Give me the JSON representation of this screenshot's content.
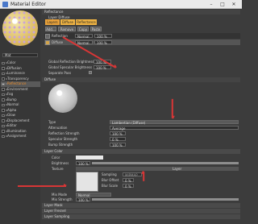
{
  "window": {
    "title": "Material Editor"
  },
  "material_name": "Mat",
  "channels": [
    {
      "label": "Color",
      "on": false
    },
    {
      "label": "Diffusion",
      "on": false
    },
    {
      "label": "Luminance",
      "on": false
    },
    {
      "label": "Transparency",
      "on": false
    },
    {
      "label": "Reflectance",
      "on": true,
      "selected": true
    },
    {
      "label": "Environment",
      "on": false
    },
    {
      "label": "Fog",
      "on": false
    },
    {
      "label": "Bump",
      "on": false
    },
    {
      "label": "Normal",
      "on": false
    },
    {
      "label": "Alpha",
      "on": false
    },
    {
      "label": "Glow",
      "on": false
    },
    {
      "label": "Displacement",
      "on": false
    },
    {
      "label": "Editor",
      "on": false
    },
    {
      "label": "Illumination",
      "on": false
    },
    {
      "label": "Assignment",
      "on": false
    }
  ],
  "reflectance": {
    "header": "Reflectance",
    "layers_header": "Layer Diffuse",
    "tabs": [
      "Layers",
      "Diffuse",
      "Reflectance"
    ],
    "buttons": [
      "Add...",
      "Remove",
      "Copy",
      "Paste"
    ],
    "layers": [
      {
        "name": "Reflection",
        "mode": "Normal",
        "value": "100 %"
      },
      {
        "name": "Diffuse",
        "mode": "Normal",
        "value": "100 %"
      }
    ],
    "global_reflection": "Global Reflection Brightness",
    "global_reflection_val": "100 %",
    "global_specular": "Global Specular Brightness",
    "global_specular_val": "100 %",
    "separate_pass": "Separate Pass"
  },
  "diffuse": {
    "header": "Diffuse",
    "type_label": "Type",
    "type_value": "Lambertian (Diffuse)",
    "attenuation_label": "Attenuation",
    "attenuation_value": "Average",
    "reflection_strength": "Reflection Strength",
    "reflection_strength_val": "100 %",
    "specular_strength": "Specular Strength",
    "specular_strength_val": "0 %",
    "bump_strength": "Bump Strength",
    "bump_strength_val": "100 %"
  },
  "layer_color": {
    "header": "Layer Color",
    "color_label": "Color",
    "brightness_label": "Brightness",
    "brightness_val": "100 %",
    "brightness_level": 1.0,
    "texture_label": "Texture",
    "texture_file": "",
    "sampling_label": "Sampling",
    "sampling_val": "MIPMAP",
    "blur_offset_label": "Blur Offset",
    "blur_offset_val": "0 %",
    "blur_scale_label": "Blur Scale",
    "blur_scale_val": "0 %",
    "texture_bar_label": "Layer",
    "mix_mode_label": "Mix Mode",
    "mix_mode_val": "Normal",
    "mix_strength_label": "Mix Strength",
    "mix_strength_val": "100 %"
  },
  "sections": [
    "Layer Mask",
    "Layer Fresnel",
    "Layer Sampling"
  ],
  "colors": {
    "accent": "#e88a2a",
    "tab_active": "#e9a23b",
    "tab": "#f0b443",
    "arrow": "#d83636"
  }
}
